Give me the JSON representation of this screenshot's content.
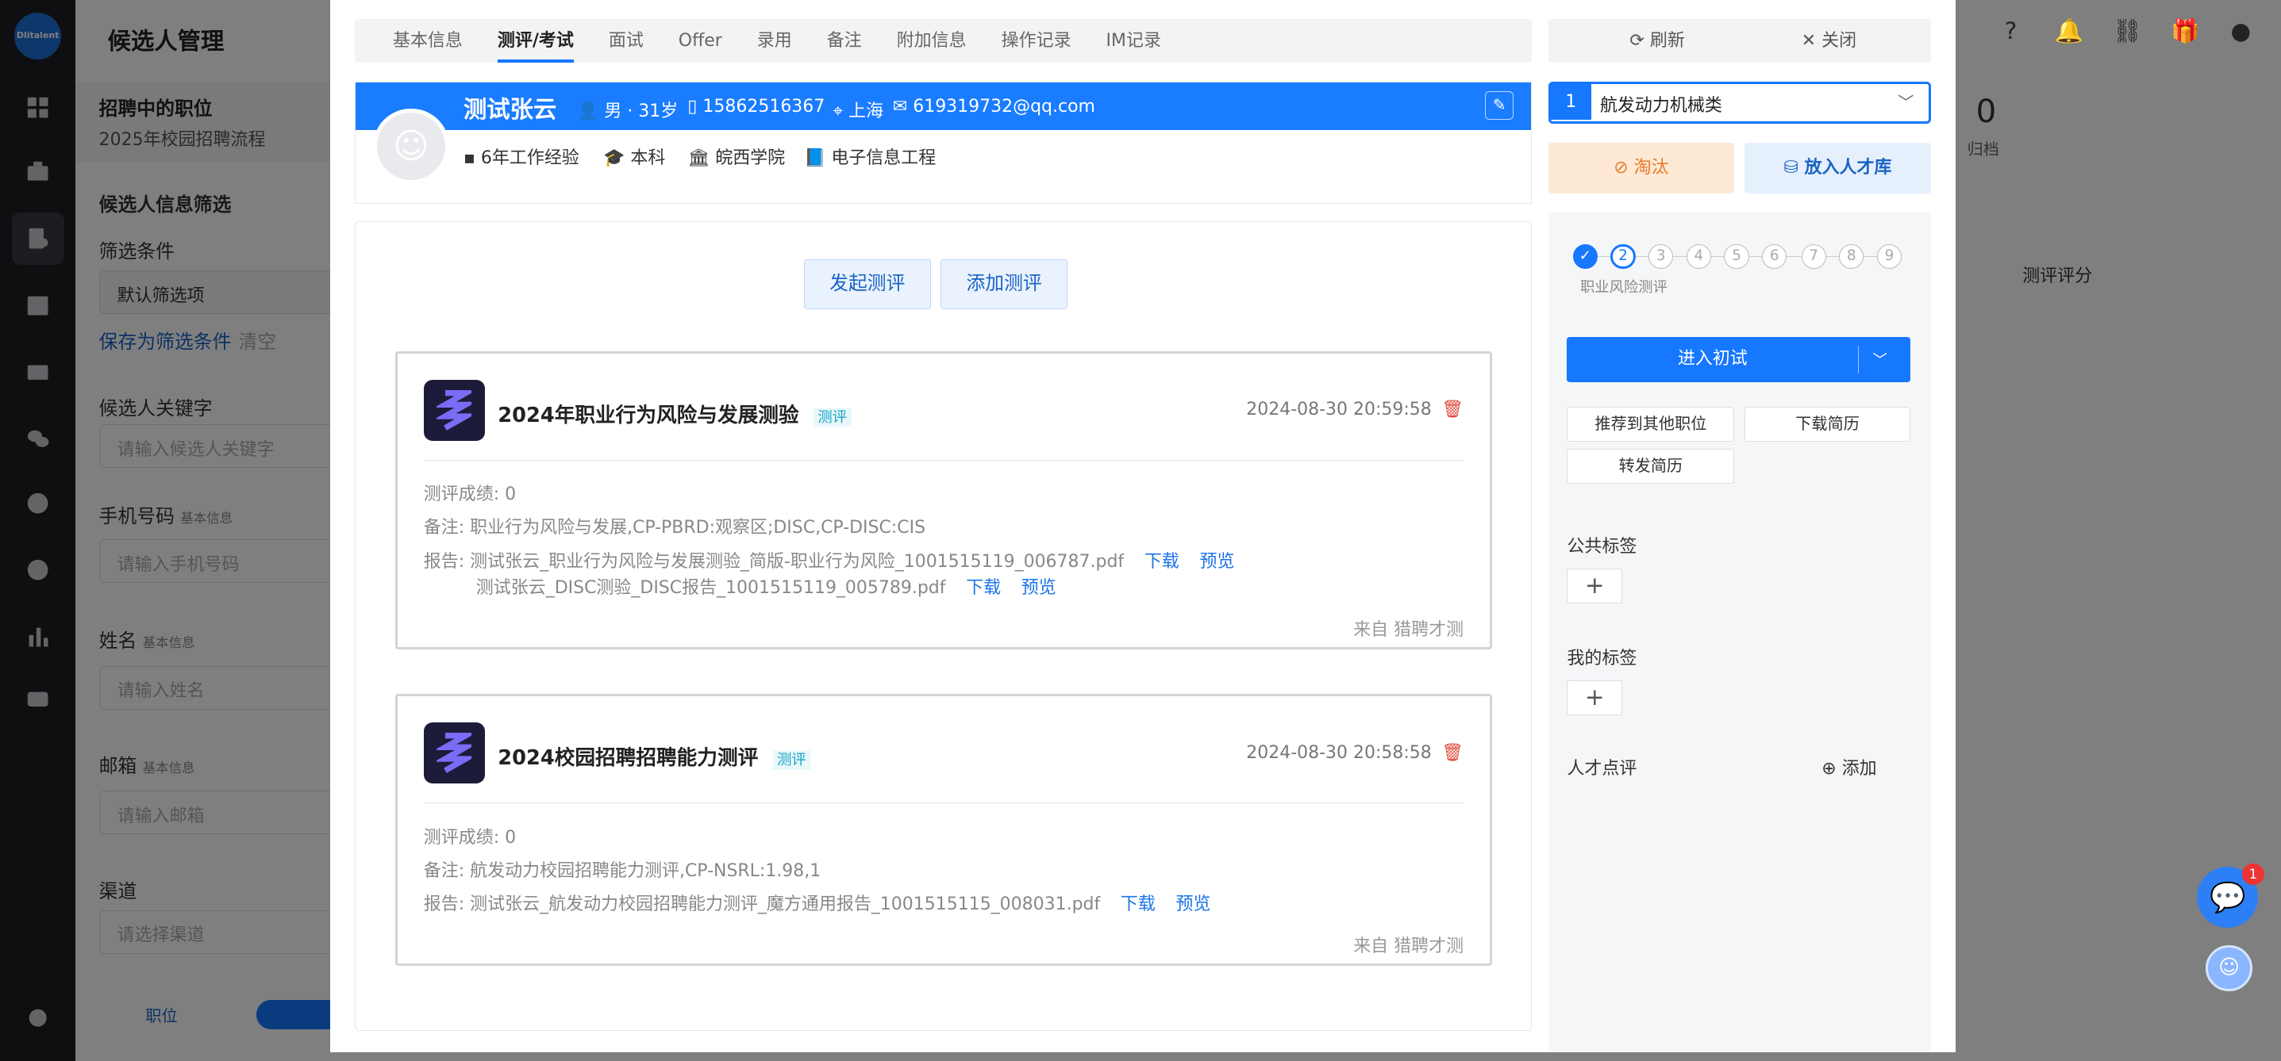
{
  "app": {
    "logo_text": "Dlitalent"
  },
  "background": {
    "page_title": "候选人管理",
    "job_section_title": "招聘中的职位",
    "job_name": "2025年校园招聘流程",
    "filter_title": "候选人信息筛选",
    "filter_label": "筛选条件",
    "filter_value": "默认筛选项",
    "save_filter": "保存为筛选条件",
    "clear": "清空",
    "keyword_label": "候选人关键字",
    "keyword_placeholder": "请输入候选人关键字",
    "phone_label": "手机号码",
    "phone_hint": "基本信息",
    "phone_placeholder": "请输入手机号码",
    "name_label": "姓名",
    "name_hint": "基本信息",
    "name_placeholder": "请输入姓名",
    "email_label": "邮箱",
    "email_hint": "基本信息",
    "email_placeholder": "请输入邮箱",
    "channel_label": "渠道",
    "channel_placeholder": "请选择渠道",
    "bottom_job_btn": "职位",
    "archive_count": "0",
    "archive_label": "归档",
    "score_col": "测评评分"
  },
  "tabs": [
    "基本信息",
    "测评/考试",
    "面试",
    "Offer",
    "录用",
    "备注",
    "附加信息",
    "操作记录",
    "IM记录"
  ],
  "candidate": {
    "name": "测试张云",
    "gender_age": "男 · 31岁",
    "phone": "15862516367",
    "city": "上海",
    "email": "619319732@qq.com",
    "experience": "6年工作经验",
    "degree": "本科",
    "school": "皖西学院",
    "major": "电子信息工程"
  },
  "actions": {
    "start_test": "发起测评",
    "add_test": "添加测评"
  },
  "tests": [
    {
      "title": "2024年职业行为风险与发展测验",
      "tag": "测评",
      "date": "2024-08-30 20:59:58",
      "score": "测评成绩: 0",
      "note": "备注: 职业行为风险与发展,CP-PBRD:观察区;DISC,CP-DISC:CIS",
      "report_label": "报告:",
      "reports": [
        "测试张云_职业行为风险与发展测验_简版-职业行为风险_1001515119_006787.pdf",
        "测试张云_DISC测验_DISC报告_1001515119_005789.pdf"
      ],
      "download": "下载",
      "preview": "预览",
      "source": "来自 猎聘才测"
    },
    {
      "title": "2024校园招聘招聘能力测评",
      "tag": "测评",
      "date": "2024-08-30 20:58:58",
      "score": "测评成绩: 0",
      "note": "备注: 航发动力校园招聘能力测评,CP-NSRL:1.98,1",
      "report_label": "报告:",
      "reports": [
        "测试张云_航发动力校园招聘能力测评_魔方通用报告_1001515115_008031.pdf"
      ],
      "download": "下载",
      "preview": "预览",
      "source": "来自 猎聘才测"
    }
  ],
  "right": {
    "refresh": "刷新",
    "close": "关闭",
    "job_index": "1",
    "job_select": "航发动力机械类",
    "reject": "淘汰",
    "talent_pool": "放入人才库",
    "steps": [
      "1",
      "2",
      "3",
      "4",
      "5",
      "6",
      "7",
      "8",
      "9"
    ],
    "current_step_label": "职业风险测评",
    "enter_interview": "进入初试",
    "recommend": "推荐到其他职位",
    "download_resume": "下载简历",
    "forward_resume": "转发简历",
    "public_tags": "公共标签",
    "my_tags": "我的标签",
    "talent_review": "人才点评",
    "add": "添加"
  },
  "chat_badge": "1",
  "colors": {
    "primary": "#1677ff",
    "banner": "#1a7cff",
    "reject_bg": "#fde9d4",
    "reject_text": "#e8792a",
    "danger": "#e0463a"
  }
}
